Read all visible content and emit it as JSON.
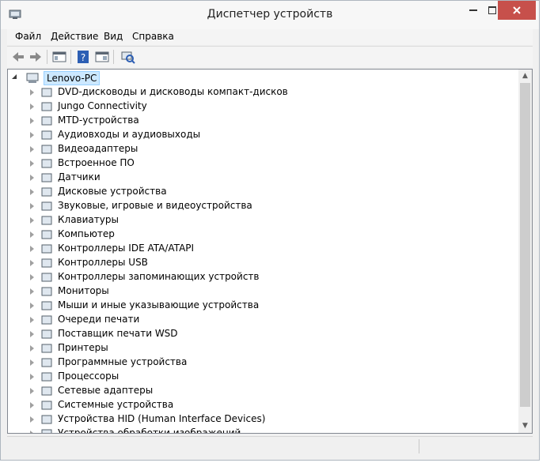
{
  "window": {
    "title": "Диспетчер устройств"
  },
  "menu": [
    "Файл",
    "Действие",
    "Вид",
    "Справка"
  ],
  "toolbar": {
    "buttons": [
      "back-arrow-icon",
      "forward-arrow-icon",
      "show-hide-tree-icon",
      "help-icon",
      "properties-icon",
      "scan-hardware-icon"
    ]
  },
  "tree": {
    "root": "Lenovo-PC",
    "nodes": [
      {
        "label": "DVD-дисководы и дисководы компакт-дисков",
        "icon": "dvd-drive-icon"
      },
      {
        "label": "Jungo Connectivity",
        "icon": "usb-device-icon"
      },
      {
        "label": "MTD-устройства",
        "icon": "storage-device-icon"
      },
      {
        "label": "Аудиовходы и аудиовыходы",
        "icon": "speaker-icon"
      },
      {
        "label": "Видеоадаптеры",
        "icon": "display-adapter-icon"
      },
      {
        "label": "Встроенное ПО",
        "icon": "firmware-chip-icon"
      },
      {
        "label": "Датчики",
        "icon": "sensor-icon"
      },
      {
        "label": "Дисковые устройства",
        "icon": "hard-disk-icon"
      },
      {
        "label": "Звуковые, игровые и видеоустройства",
        "icon": "sound-icon"
      },
      {
        "label": "Клавиатуры",
        "icon": "keyboard-icon"
      },
      {
        "label": "Компьютер",
        "icon": "computer-icon"
      },
      {
        "label": "Контроллеры IDE ATA/ATAPI",
        "icon": "ide-controller-icon"
      },
      {
        "label": "Контроллеры USB",
        "icon": "usb-plug-icon"
      },
      {
        "label": "Контроллеры запоминающих устройств",
        "icon": "storage-controller-icon"
      },
      {
        "label": "Мониторы",
        "icon": "monitor-icon"
      },
      {
        "label": "Мыши и иные указывающие устройства",
        "icon": "mouse-icon"
      },
      {
        "label": "Очереди печати",
        "icon": "print-queue-icon"
      },
      {
        "label": "Поставщик печати WSD",
        "icon": "wsd-printer-icon"
      },
      {
        "label": "Принтеры",
        "icon": "printer-icon"
      },
      {
        "label": "Программные устройства",
        "icon": "software-device-icon"
      },
      {
        "label": "Процессоры",
        "icon": "processor-icon"
      },
      {
        "label": "Сетевые адаптеры",
        "icon": "network-adapter-icon"
      },
      {
        "label": "Системные устройства",
        "icon": "system-device-icon"
      },
      {
        "label": "Устройства HID (Human Interface Devices)",
        "icon": "hid-device-icon"
      },
      {
        "label": "Устройства обработки изображений",
        "icon": "imaging-device-icon"
      }
    ]
  },
  "colors": {
    "selection_bg": "#cce8ff",
    "close_button": "#c7504b"
  }
}
